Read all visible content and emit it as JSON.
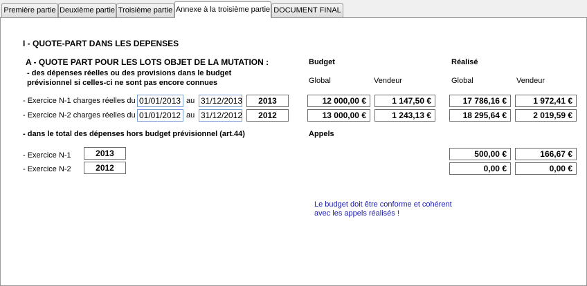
{
  "tabs": [
    {
      "label": "Première partie",
      "active": false
    },
    {
      "label": "Deuxième partie",
      "active": false
    },
    {
      "label": "Troisième partie",
      "active": false
    },
    {
      "label": "Annexe à la troisième partie",
      "active": true
    },
    {
      "label": "DOCUMENT FINAL",
      "active": false
    }
  ],
  "section_title": "I - QUOTE-PART DANS LES DEPENSES",
  "subsection_a": {
    "title": "A - QUOTE PART POUR LES LOTS OBJET DE LA MUTATION :",
    "description_line1": "- des dépenses réelles ou des provisions dans le budget",
    "description_line2": "prévisionnel si celles-ci ne sont pas encore connues"
  },
  "columns": {
    "budget": "Budget",
    "realise": "Réalisé",
    "global": "Global",
    "vendeur": "Vendeur"
  },
  "exercices": [
    {
      "label": "- Exercice N-1 charges réelles  du",
      "date_from": "01/01/2013",
      "au": "au",
      "date_to": "31/12/2013",
      "year": "2013",
      "budget_global": "12 000,00 €",
      "budget_vendeur": "1 147,50 €",
      "realise_global": "17 786,16 €",
      "realise_vendeur": "1 972,41 €"
    },
    {
      "label": "- Exercice N-2 charges réelles  du",
      "date_from": "01/01/2012",
      "au": "au",
      "date_to": "31/12/2012",
      "year": "2012",
      "budget_global": "13 000,00 €",
      "budget_vendeur": "1 243,13 €",
      "realise_global": "18 295,64 €",
      "realise_vendeur": "2 019,59 €"
    }
  ],
  "hors_budget": {
    "title": "- dans le total des dépenses hors budget prévisionnel (art.44)",
    "appels": "Appels",
    "rows": [
      {
        "label": "- Exercice  N-1",
        "year": "2013",
        "global": "500,00 €",
        "vendeur": "166,67 €"
      },
      {
        "label": "- Exercice  N-2",
        "year": "2012",
        "global": "0,00 €",
        "vendeur": "0,00 €"
      }
    ]
  },
  "note_line1": "Le budget doit être conforme et cohérent",
  "note_line2": "avec les appels réalisés !"
}
